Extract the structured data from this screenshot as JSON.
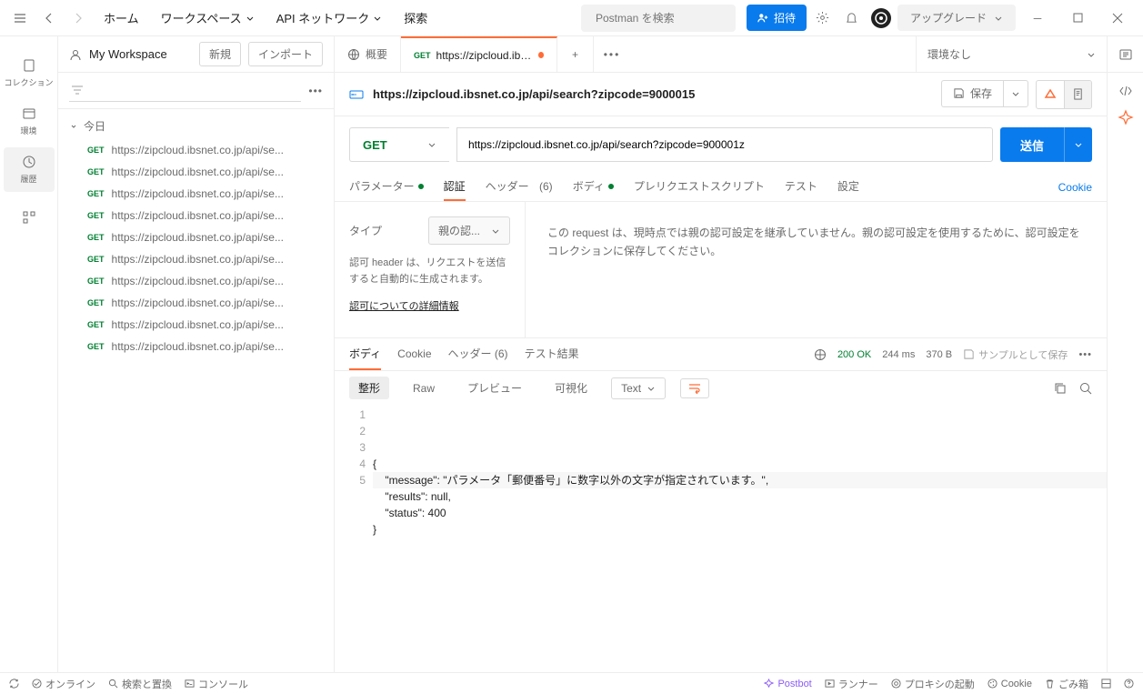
{
  "topbar": {
    "home": "ホーム",
    "workspaces": "ワークスペース",
    "api_network": "API ネットワーク",
    "explore": "探索",
    "search_placeholder": "Postman を検索",
    "invite": "招待",
    "upgrade": "アップグレード"
  },
  "rail": {
    "collections": "コレクション",
    "environments": "環境",
    "history": "履歴"
  },
  "sidebar": {
    "workspace_title": "My Workspace",
    "new_btn": "新規",
    "import_btn": "インポート",
    "group_today": "今日",
    "history_items": [
      {
        "method": "GET",
        "url": "https://zipcloud.ibsnet.co.jp/api/se..."
      },
      {
        "method": "GET",
        "url": "https://zipcloud.ibsnet.co.jp/api/se..."
      },
      {
        "method": "GET",
        "url": "https://zipcloud.ibsnet.co.jp/api/se..."
      },
      {
        "method": "GET",
        "url": "https://zipcloud.ibsnet.co.jp/api/se..."
      },
      {
        "method": "GET",
        "url": "https://zipcloud.ibsnet.co.jp/api/se..."
      },
      {
        "method": "GET",
        "url": "https://zipcloud.ibsnet.co.jp/api/se..."
      },
      {
        "method": "GET",
        "url": "https://zipcloud.ibsnet.co.jp/api/se..."
      },
      {
        "method": "GET",
        "url": "https://zipcloud.ibsnet.co.jp/api/se..."
      },
      {
        "method": "GET",
        "url": "https://zipcloud.ibsnet.co.jp/api/se..."
      },
      {
        "method": "GET",
        "url": "https://zipcloud.ibsnet.co.jp/api/se..."
      }
    ]
  },
  "tabs": {
    "overview": "概要",
    "active_method": "GET",
    "active_label": "https://zipcloud.ibsnet"
  },
  "environment": {
    "none": "環境なし"
  },
  "breadcrumb": {
    "title": "https://zipcloud.ibsnet.co.jp/api/search?zipcode=9000015",
    "save": "保存"
  },
  "request": {
    "method": "GET",
    "url": "https://zipcloud.ibsnet.co.jp/api/search?zipcode=900001z",
    "send": "送信"
  },
  "req_tabs": {
    "params": "パラメーター",
    "auth": "認証",
    "headers": "ヘッダー",
    "headers_count": "(6)",
    "body": "ボディ",
    "prerequest": "プレリクエストスクリプト",
    "tests": "テスト",
    "settings": "設定",
    "cookie": "Cookie"
  },
  "auth": {
    "type_label": "タイプ",
    "type_value": "親の認...",
    "note": "認可 header は、リクエストを送信すると自動的に生成されます。",
    "link": "認可についての詳細情報",
    "message": "この request は、現時点では親の認可設定を継承していません。親の認可設定を使用するために、認可設定をコレクションに保存してください。"
  },
  "resp_tabs": {
    "body": "ボディ",
    "cookie": "Cookie",
    "headers": "ヘッダー",
    "headers_count": "(6)",
    "tests": "テスト結果",
    "status_code": "200",
    "status_text": "OK",
    "time": "244 ms",
    "size": "370 B",
    "save_example": "サンプルとして保存"
  },
  "resp_tools": {
    "pretty": "整形",
    "raw": "Raw",
    "preview": "プレビュー",
    "visualize": "可視化",
    "text": "Text"
  },
  "response_body": {
    "lines": [
      "{",
      "    \"message\": \"パラメータ「郵便番号」に数字以外の文字が指定されています。\",",
      "    \"results\": null,",
      "    \"status\": 400",
      "}"
    ]
  },
  "footer": {
    "online": "オンライン",
    "find_replace": "検索と置換",
    "console": "コンソール",
    "postbot": "Postbot",
    "runner": "ランナー",
    "proxy": "プロキシの起動",
    "cookie": "Cookie",
    "trash": "ごみ箱"
  }
}
